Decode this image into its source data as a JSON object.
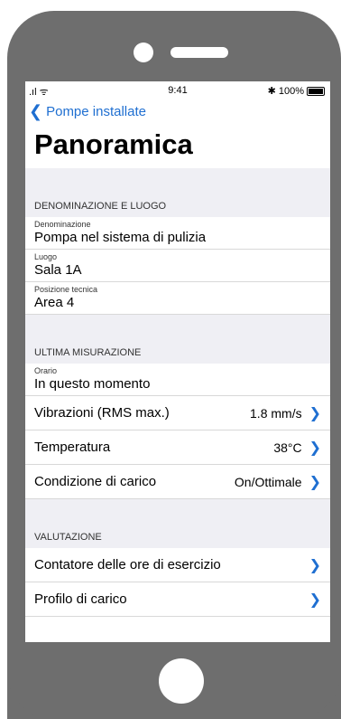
{
  "status": {
    "signal": ".ıl ᯤ",
    "time": "9:41",
    "bluetooth": "✱",
    "battery": "100%"
  },
  "nav": {
    "back_label": "Pompe installate"
  },
  "title": "Panoramica",
  "sections": [
    {
      "header": "DENOMINAZIONE E LUOGO",
      "rows": [
        {
          "label": "Denominazione",
          "value": "Pompa nel sistema di pulizia"
        },
        {
          "label": "Luogo",
          "value": "Sala 1A"
        },
        {
          "label": "Posizione tecnica",
          "value": "Area 4"
        }
      ]
    },
    {
      "header": "ULTIMA MISURAZIONE",
      "rows": [
        {
          "label": "Orario",
          "value": "In questo momento"
        }
      ],
      "nav_rows": [
        {
          "name": "Vibrazioni (RMS max.)",
          "value": "1.8 mm/s"
        },
        {
          "name": "Temperatura",
          "value": "38°C"
        },
        {
          "name": "Condizione di carico",
          "value": "On/Ottimale"
        }
      ]
    },
    {
      "header": "VALUTAZIONE",
      "nav_rows": [
        {
          "name": "Contatore delle ore di esercizio",
          "value": ""
        },
        {
          "name": "Profilo di carico",
          "value": ""
        }
      ]
    }
  ],
  "icons": {
    "back": "chevron-left-icon",
    "forward": "chevron-right-icon"
  },
  "colors": {
    "accent": "#1f6fd1",
    "section_bg": "#efeff4",
    "device": "#6e6e6e"
  }
}
